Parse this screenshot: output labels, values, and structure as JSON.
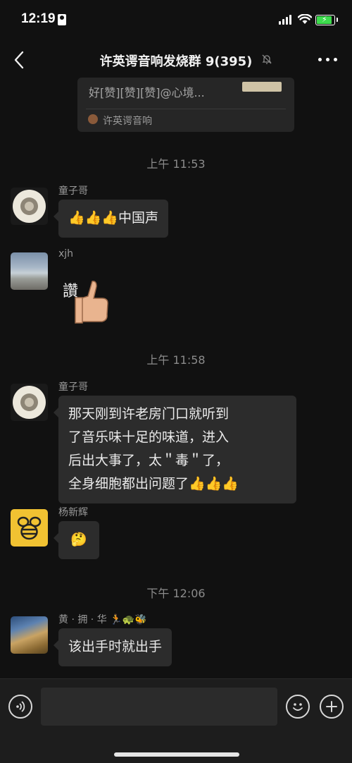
{
  "status_bar": {
    "time": "12:19"
  },
  "nav": {
    "title": "许英谔音响发烧群 9(395)"
  },
  "quote": {
    "text": "好[赞][赞][赞]@心境...",
    "source": "许英谔音响"
  },
  "messages": {
    "sep1": "上午 11:53",
    "m1": {
      "sender": "童子哥",
      "text": "中国声"
    },
    "m2": {
      "sender": "xjh",
      "sticker_label": "讚"
    },
    "sep2": "上午 11:58",
    "m3": {
      "sender": "童子哥",
      "line1": "那天刚到许老房门口就听到",
      "line2": "了音乐味十足的味道，进入",
      "line3": "后出大事了，太＂毒＂了，",
      "line4": "全身细胞都出问题了"
    },
    "m4": {
      "sender": "杨新辉",
      "emoji": "🤔"
    },
    "sep3": "下午 12:06",
    "m5": {
      "sender": "黄 · 拥 · 华",
      "sender_emojis": "🏃🐢🐝",
      "text": "该出手时就出手"
    }
  },
  "colors": {
    "background": "#111111",
    "bubble": "#2c2c2c",
    "accent_green": "#3ddc4d"
  },
  "icons": [
    "back-icon",
    "mute-icon",
    "more-icon",
    "voice-icon",
    "emoji-icon",
    "plus-icon",
    "thumbs-up-icon"
  ]
}
